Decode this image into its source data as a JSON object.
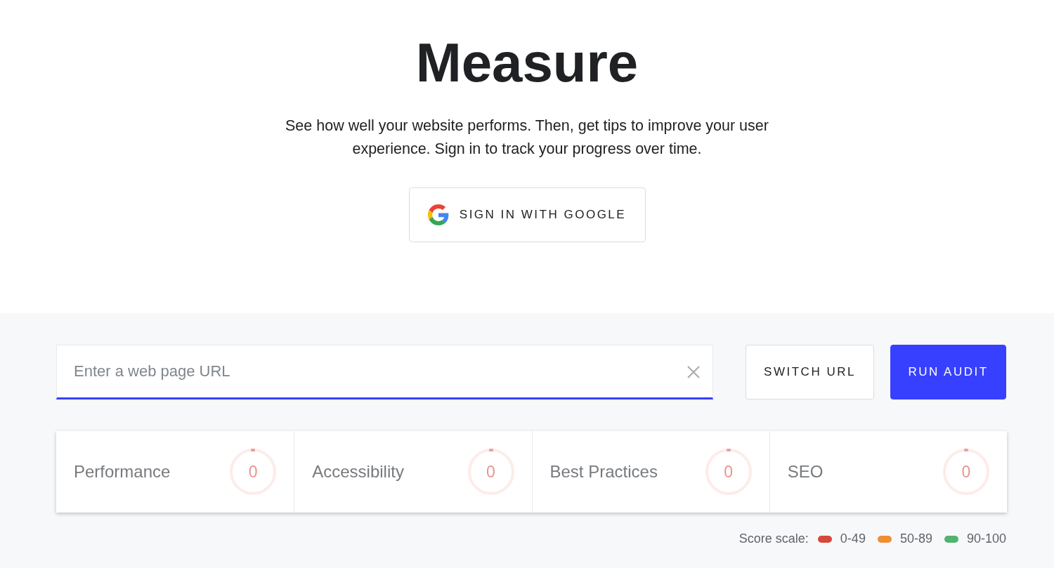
{
  "header": {
    "title": "Measure",
    "description": "See how well your website performs. Then, get tips to improve your user experience. Sign in to track your progress over time.",
    "sign_in_button": {
      "label": "SIGN IN WITH GOOGLE"
    }
  },
  "audit_form": {
    "url_field": {
      "placeholder": "Enter a web page URL"
    },
    "buttons": [
      {
        "label": "SWITCH URL",
        "kind": "secondary"
      },
      {
        "label": "RUN AUDIT",
        "kind": "primary"
      }
    ]
  },
  "scores": [
    {
      "category": "Performance",
      "score": "0"
    },
    {
      "category": "Accessibility",
      "score": "0"
    },
    {
      "category": "Best Practices",
      "score": "0"
    },
    {
      "category": "SEO",
      "score": "0"
    }
  ],
  "score_scale": {
    "label": "Score scale:",
    "ranges": [
      {
        "label": "0-49",
        "color": "#d9463b"
      },
      {
        "label": "50-89",
        "color": "#ef8f35"
      },
      {
        "label": "90-100",
        "color": "#53b270"
      }
    ]
  }
}
